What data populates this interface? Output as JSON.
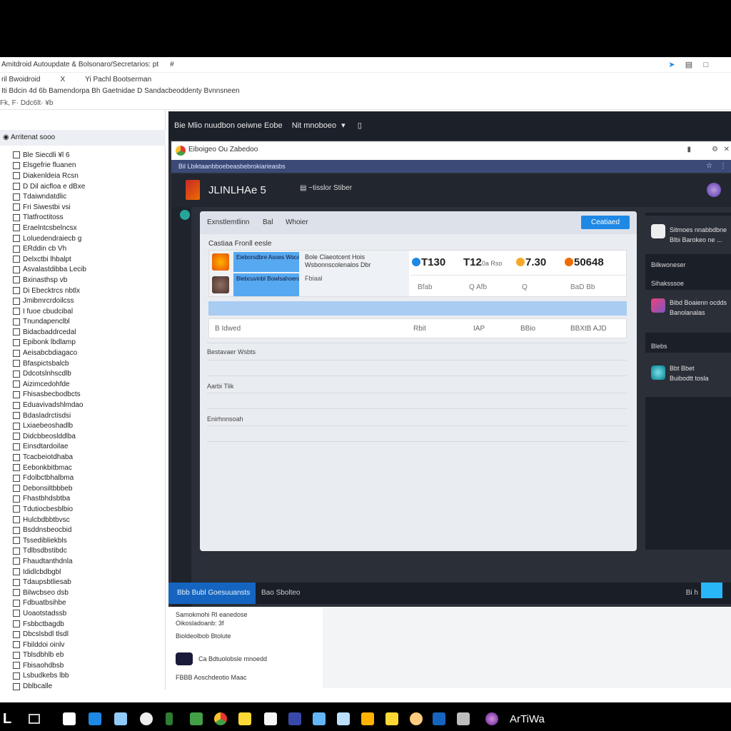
{
  "window": {
    "title": "Amitdroid Autoupdate & Bolsonaro/Secretarios: pt",
    "title_icon": "#"
  },
  "menubar": {
    "items": [
      "ril Bwoidroid",
      "X",
      "Yi Pachl Bootserman",
      ""
    ]
  },
  "toolbar_text": "Iti Bdcin 4d 6b Bamendorpa Bh Gaetnidae D Sandacbeoddenty Bvnnsneen",
  "address_text": "Fk, F· Ddc6lt· ¥b",
  "left_panel": {
    "header": "Arritenat sooo",
    "items": [
      "Ble Siecdli ¥l 6",
      "Elsgefrie fluanen",
      "Diakenldeia Rcsn",
      "D Dil aicfloa e dBxe",
      "Tdaiwndatdlic",
      "Fri Siwestbi vsi",
      "Tlatfroctitoss",
      "Eraelntcsbelncsx",
      "Loluedendraiecb g",
      "ERddin cb Vh",
      "Delxctbi lhbalpt",
      "Asvalastdibba Lecib",
      "Bxinasthsp vb",
      "Di Ebecktrcs nbtlx",
      "Jmibmrcrdoilcss",
      "I fuoe cbudcibal",
      "Tnundapenclbl",
      "Bidacbaddrcedal",
      "Epibonk lbdlamp",
      "Aeisabcbdiagaco",
      "Bfaspictsbalcb",
      "Ddcotslnhscdlb",
      "Aizimcedohfde",
      "Fhisasbecbodbcts",
      "Eduavivadshlmdao",
      "Bdasladrctisdsi",
      "Lxiaebeoshadlb",
      "Didcbbeoslddlba",
      "Einsdtardoilae",
      "Tcacbeiotdhaba",
      "Eebonkbitbmac",
      "Fdolbctbhalbma",
      "Debonsiltbbbeb",
      "Fhastbhdsbtba",
      "Tdutiocbesblbio",
      "Hulcbdbbtbvsc",
      "Bsddnsbeocbid",
      "Tssedibliekbls",
      "Tdlbsdbstibdc",
      "Fhaudtanthdnla",
      "Ididlcbdbgbl",
      "Tdaupsbtliesab",
      "Bilwcbseo dsb",
      "Fdbuatbsihbe",
      "Uoaotstadssb",
      "Fsbbctbagdb",
      "Dbcslsbdl tlsdl",
      "Fbilddoi oinlv",
      "Tblsdbhlb eb",
      "Fbisaohdbsb",
      "Lsbudkebs lbb",
      "Dblbcalle"
    ]
  },
  "browser": {
    "top_title": "Bie Mlio nuudbon oeiwne Eobe",
    "top_menu": "Nit mnoboeo",
    "tab_title": "Eiboigeo Ou Zabedoo",
    "url_text": "Bil Lbiktaanbboebeasbebrokiarieasbs"
  },
  "site": {
    "name": "JLINLHAe 5",
    "nav": "~tisslor Stiber"
  },
  "card": {
    "tabs": [
      "Exnstlemtlinn",
      "Bal",
      "Whoier"
    ],
    "button_label": "Ceatiaed",
    "subtitle": "Castiaa Fronll eesle",
    "offer_box_1": "Eieborsdbre Asoes Wscahdoriawoclar abiowe",
    "offer_box_2": "Biebcuvinbl Bowlsahoerabi bisslocse",
    "offer_desc_1": "Bole Claeotcent Hois",
    "offer_desc_2": "Wsbonnscolenalos Dbr",
    "offer_meta": "Fbiaal",
    "stats": [
      {
        "value": "T130",
        "suffix": "",
        "label": "Bfab",
        "dot": "#1e88e5"
      },
      {
        "value": "T12",
        "suffix": "0a Rso",
        "label": "Q Afb",
        "dot": ""
      },
      {
        "value": "7.30",
        "suffix": "",
        "label": "Q",
        "dot": "#f9a825"
      },
      {
        "value": "50648",
        "suffix": "",
        "label": "BaD Bb",
        "dot": "#ef6c00"
      }
    ],
    "progress": 1.0,
    "row_cells": [
      "B Idwed",
      "Rbit",
      "IAP",
      "BBio",
      "BBXtB AJD"
    ],
    "sections": [
      "Bestavaer Wsbts",
      "Aarbi Tlik",
      "Enirhnnsoah"
    ]
  },
  "right_panel": {
    "card1_lines": [
      "Sitmoes nnabbdbne",
      "Blbi Barokeo ne ..."
    ],
    "header1": "Bilkwoneser",
    "header2": "Sihaksssoe",
    "card2_lines": [
      "Bibd Boaienn ocdds",
      "Banolanalas"
    ],
    "header3": "Blebs",
    "card3_lines": [
      "Bbt Bbet",
      "Buibodtt tosla"
    ]
  },
  "status_bar": {
    "left": "Bbb Bubl Goesuuansts",
    "mid": "Bao Sbolteo",
    "right": "Bi h"
  },
  "bottom_pane": {
    "line1": "Samokmohi Rl eanedose",
    "line2": "Oikosladoanb: 3f",
    "line3": "Bioldeolbob Btolute",
    "line4": "Ca Bdtuolobsle mnoedd",
    "line5": "FBBB Aoschdeotio Maac"
  },
  "taskbar": {
    "start": "L",
    "label": "ArTiWa"
  }
}
